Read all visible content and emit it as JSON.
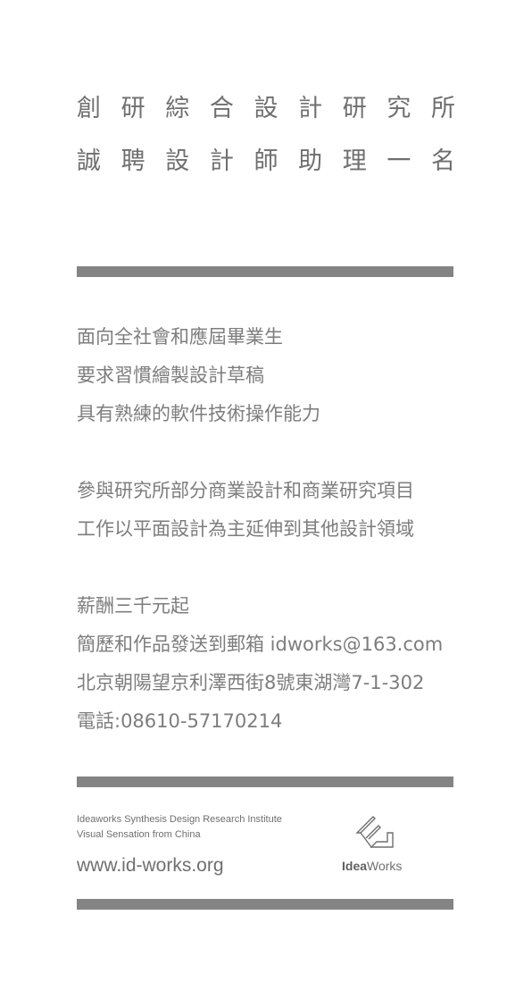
{
  "title": {
    "line1": [
      "創",
      "研",
      "綜",
      "合",
      "設",
      "計",
      "研",
      "究",
      "所"
    ],
    "line2": [
      "誠",
      "聘",
      "設",
      "計",
      "師",
      "助",
      "理",
      "一",
      "名"
    ]
  },
  "requirements": [
    "面向全社會和應屆畢業生",
    "要求習慣繪製設計草稿",
    "具有熟練的軟件技術操作能力"
  ],
  "duties": [
    "參與研究所部分商業設計和商業研究項目",
    "工作以平面設計為主延伸到其他設計領域"
  ],
  "contact": [
    "薪酬三千元起",
    "簡歷和作品發送到郵箱 idworks@163.com",
    "北京朝陽望京利澤西街8號東湖灣7-1-302",
    "電話:08610-57170214"
  ],
  "footer": {
    "org_name": "Ideaworks Synthesis Design Research Institute",
    "tagline": "Visual Sensation from China",
    "url": "www.id-works.org",
    "logo_bold": "Idea",
    "logo_regular": "Works",
    "logo_icon": "ideaworks-logo-icon"
  },
  "colors": {
    "bar": "#848484",
    "text": "#7a7a7a"
  }
}
